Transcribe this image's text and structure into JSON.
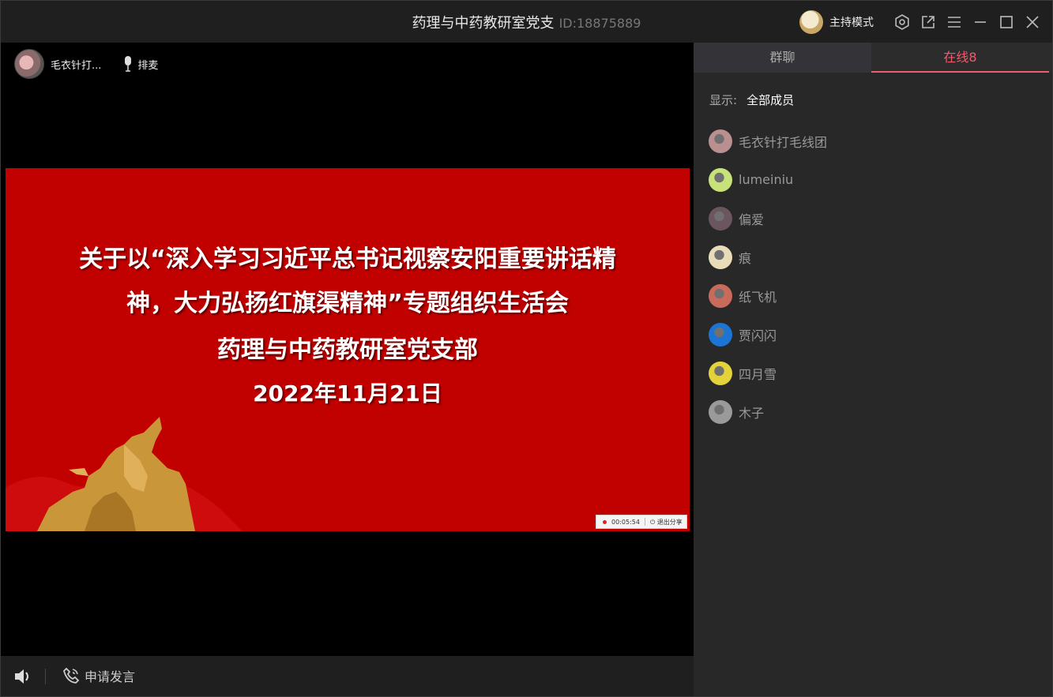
{
  "window": {
    "title": "药理与中药教研室党支",
    "room_id": "ID:18875889",
    "mode_label": "主持模式"
  },
  "stage": {
    "speaker_name": "毛衣针打...",
    "mic_queue_label": "排麦",
    "slide": {
      "line1": "关于以“深入学习习近平总书记视察安阳重要讲话精",
      "line2": "神，大力弘扬红旗渠精神”专题组织生活会",
      "line3": "药理与中药教研室党支部",
      "line4": "2022年11月21日"
    },
    "share": {
      "timer": "00:05:54",
      "exit_label": "退出分享"
    }
  },
  "bottom": {
    "request_speak_label": "申请发言"
  },
  "panel": {
    "tabs": [
      {
        "label": "群聊"
      },
      {
        "label": "在线8"
      }
    ],
    "filter_label": "显示:",
    "filter_value": "全部成员",
    "members": [
      {
        "name": "毛衣针打毛线团",
        "avatar": "#b98f8f"
      },
      {
        "name": "lumeiniu",
        "avatar": "#c8e27a"
      },
      {
        "name": "偏爱",
        "avatar": "#6b5660"
      },
      {
        "name": "痕",
        "avatar": "#e9dcb8"
      },
      {
        "name": "纸飞机",
        "avatar": "#c96a5a"
      },
      {
        "name": "贾闪闪",
        "avatar": "#1c74d4"
      },
      {
        "name": "四月雪",
        "avatar": "#e3d23a"
      },
      {
        "name": "木子",
        "avatar": "#9a9a9a"
      }
    ]
  },
  "colors": {
    "accent": "#f05a6e",
    "slide_bg": "#c10000"
  }
}
